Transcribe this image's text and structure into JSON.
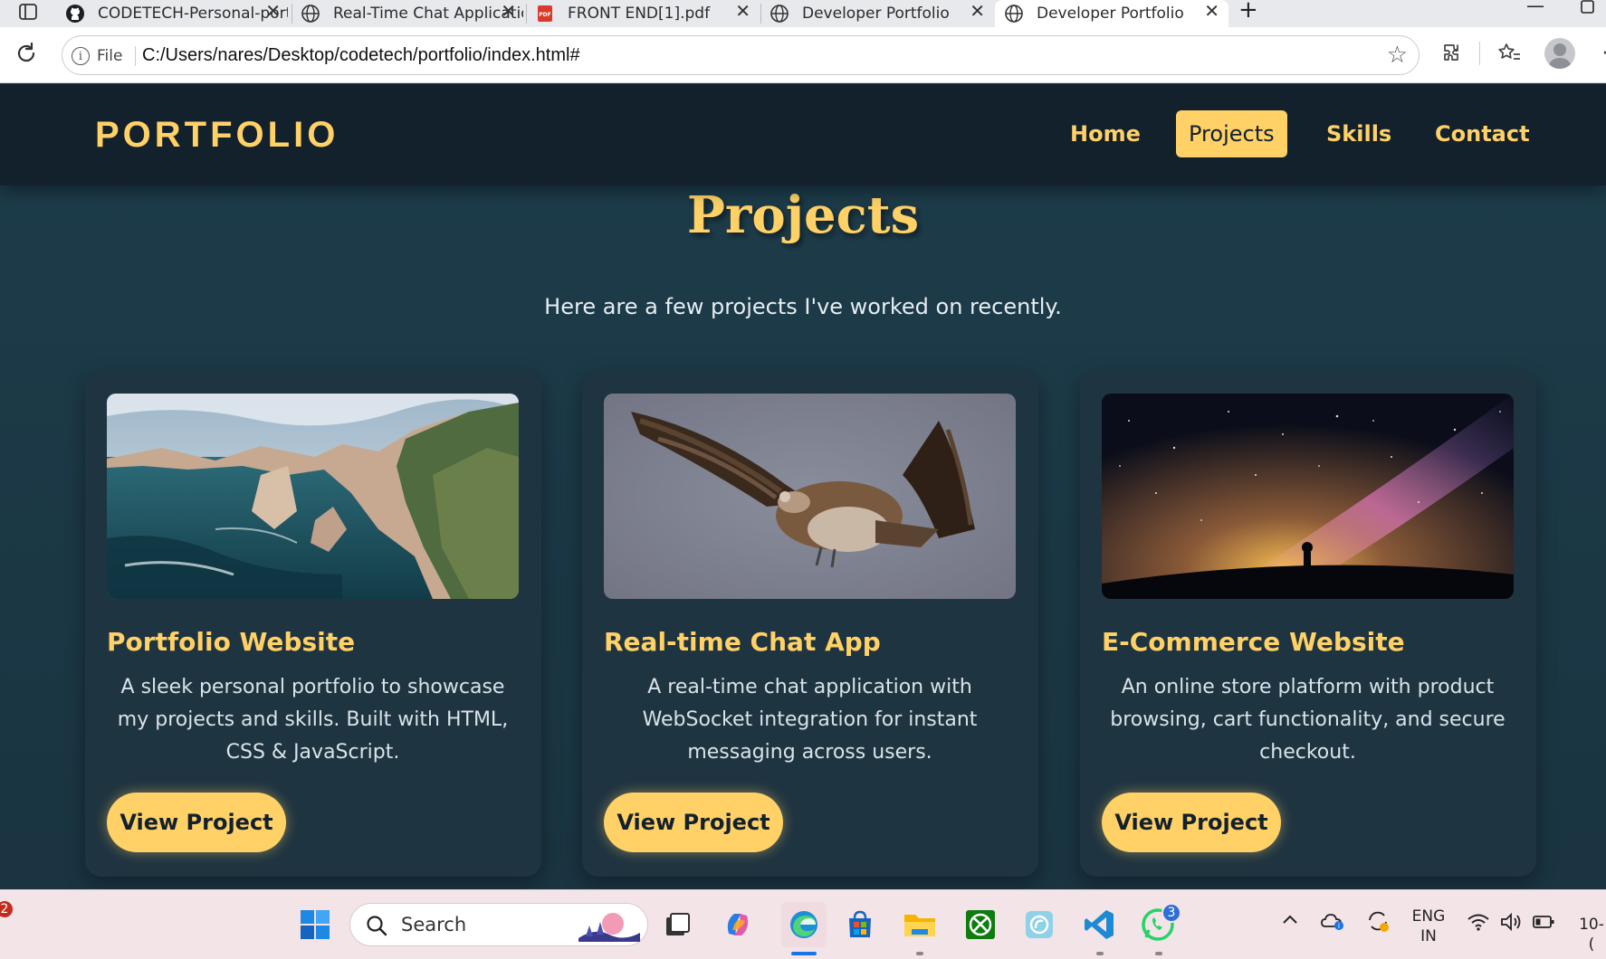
{
  "browser": {
    "tabs": [
      {
        "title": "CODETECH-Personal-portfolio",
        "icon": "github-icon",
        "active": false
      },
      {
        "title": "Real-Time Chat Application",
        "icon": "globe-icon",
        "active": false
      },
      {
        "title": "FRONT END[1].pdf",
        "icon": "pdf-icon",
        "active": false
      },
      {
        "title": "Developer Portfolio",
        "icon": "globe-icon",
        "active": false
      },
      {
        "title": "Developer Portfolio",
        "icon": "globe-icon",
        "active": true
      }
    ],
    "file_label": "File",
    "url": "C:/Users/nares/Desktop/codetech/portfolio/index.html#"
  },
  "site": {
    "logo": "PORTFOLIO",
    "nav": [
      {
        "label": "Home",
        "active": false
      },
      {
        "label": "Projects",
        "active": true
      },
      {
        "label": "Skills",
        "active": false
      },
      {
        "label": "Contact",
        "active": false
      }
    ],
    "section_title": "Projects",
    "section_subtitle": "Here are a few projects I've worked on recently.",
    "projects": [
      {
        "title": "Portfolio Website",
        "description": "A sleek personal portfolio to showcase my projects and skills. Built with HTML, CSS & JavaScript.",
        "button": "View Project",
        "image": "coastal-cliffs-photo"
      },
      {
        "title": "Real-time Chat App",
        "description": "A real-time chat application with WebSocket integration for instant messaging across users.",
        "button": "View Project",
        "image": "vulture-flying-photo"
      },
      {
        "title": "E-Commerce Website",
        "description": "An online store platform with product browsing, cart functionality, and secure checkout.",
        "button": "View Project",
        "image": "milky-way-night-sky-photo"
      }
    ]
  },
  "taskbar": {
    "search_placeholder": "Search",
    "notification_count": "2",
    "whatsapp_badge": "3",
    "language_line1": "ENG",
    "language_line2": "IN",
    "clock_partial": "10-("
  },
  "colors": {
    "accent": "#ffd166",
    "nav_bg": "#13212d",
    "page_bg": "#1d3b48",
    "card_bg": "#1f3441"
  }
}
